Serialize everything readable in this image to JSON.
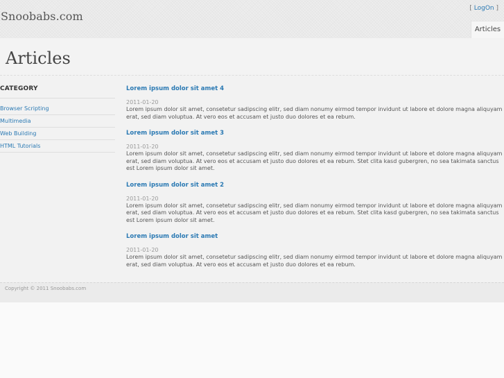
{
  "header": {
    "site_title": "Snoobabs.com",
    "logon_open": "[ ",
    "logon_label": "LogOn",
    "logon_close": " ]",
    "nav": [
      {
        "label": "Articles"
      }
    ]
  },
  "page": {
    "heading": "Articles"
  },
  "sidebar": {
    "heading": "CATEGORY",
    "items": [
      {
        "label": "Browser Scripting"
      },
      {
        "label": "Multimedia"
      },
      {
        "label": "Web Building"
      },
      {
        "label": "HTML Tutorials"
      }
    ]
  },
  "articles": [
    {
      "title": "Lorem ipsum dolor sit amet 4",
      "date": "2011-01-20",
      "body": "Lorem ipsum dolor sit amet, consetetur sadipscing elitr, sed diam nonumy eirmod tempor invidunt ut labore et dolore magna aliquyam erat, sed diam voluptua. At vero eos et accusam et justo duo dolores et ea rebum."
    },
    {
      "title": "Lorem ipsum dolor sit amet 3",
      "date": "2011-01-20",
      "body": "Lorem ipsum dolor sit amet, consetetur sadipscing elitr, sed diam nonumy eirmod tempor invidunt ut labore et dolore magna aliquyam erat, sed diam voluptua. At vero eos et accusam et justo duo dolores et ea rebum. Stet clita kasd gubergren, no sea takimata sanctus est Lorem ipsum dolor sit amet."
    },
    {
      "title": "Lorem ipsum dolor sit amet 2",
      "date": "2011-01-20",
      "body": "Lorem ipsum dolor sit amet, consetetur sadipscing elitr, sed diam nonumy eirmod tempor invidunt ut labore et dolore magna aliquyam erat, sed diam voluptua. At vero eos et accusam et justo duo dolores et ea rebum. Stet clita kasd gubergren, no sea takimata sanctus est Lorem ipsum dolor sit amet."
    },
    {
      "title": "Lorem ipsum dolor sit amet",
      "date": "2011-01-20",
      "body": "Lorem ipsum dolor sit amet, consetetur sadipscing elitr, sed diam nonumy eirmod tempor invidunt ut labore et dolore magna aliquyam erat, sed diam voluptua. At vero eos et accusam et justo duo dolores et ea rebum."
    }
  ],
  "footer": {
    "copyright": "Copyright © 2011 Snoobabs.com"
  },
  "colors": {
    "link": "#2a79b3",
    "text": "#555555",
    "muted": "#999999"
  }
}
